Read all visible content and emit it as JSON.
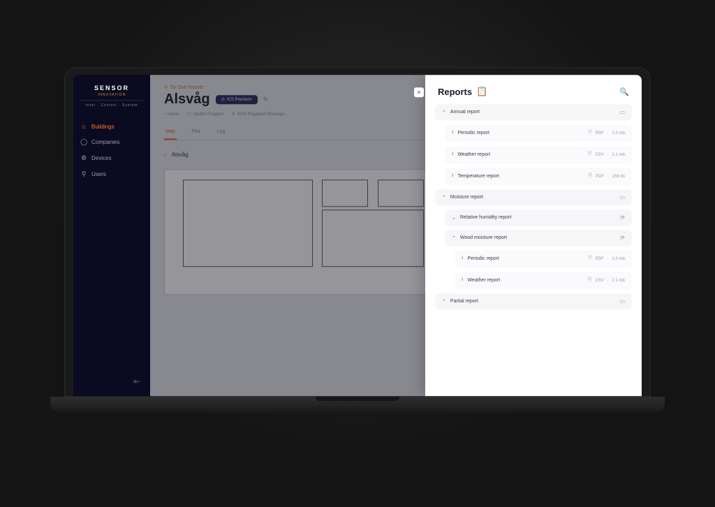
{
  "logo": {
    "name": "SENSOR",
    "sub": "INNOVATION",
    "tag": "Intel · Control · System"
  },
  "nav": {
    "items": [
      {
        "icon": "⌂",
        "label": "Buildings",
        "active": true
      },
      {
        "icon": "◯",
        "label": "Companies"
      },
      {
        "icon": "⚙",
        "label": "Devices"
      },
      {
        "icon": "⚲",
        "label": "Users"
      }
    ]
  },
  "page": {
    "owner_icon": "⚲",
    "owner": "Tor Ove Nesset",
    "title": "Alsvåg",
    "badge_icon": "◷",
    "badge": "ICS Premium",
    "edit_icon": "✎",
    "meta": [
      {
        "icon": "•",
        "text": "native"
      },
      {
        "icon": "▢",
        "text": "Vestbo Gruppen"
      },
      {
        "icon": "⚲",
        "text": "4015 Rogaland Stavange..."
      }
    ],
    "tabs": [
      {
        "label": "Map",
        "active": true
      },
      {
        "label": "Plot"
      },
      {
        "label": "Log"
      }
    ],
    "breadcrumb_icon": "‹",
    "breadcrumb": "Alsvåg"
  },
  "panel": {
    "close": "✕",
    "title": "Reports",
    "title_icon": "📋",
    "search_icon": "🔍",
    "rows": [
      {
        "type": "grp",
        "chev": "⌃",
        "label": "Annual report",
        "cls": ""
      },
      {
        "type": "file",
        "label": "Periodic report",
        "fmt": "PDF",
        "size": "1.0 mb",
        "cls": ""
      },
      {
        "type": "file",
        "label": "Weather report",
        "fmt": "CSV",
        "size": "2.1 mb",
        "cls": ""
      },
      {
        "type": "file",
        "label": "Temperature report",
        "fmt": "PDF",
        "size": "256 kb",
        "cls": ""
      },
      {
        "type": "grp",
        "chev": "⌃",
        "label": "Moisture report",
        "cls": ""
      },
      {
        "type": "grp",
        "chev": "⌄",
        "label": "Relative humidity report",
        "cls": "sub",
        "folder": "⟳"
      },
      {
        "type": "grp",
        "chev": "⌃",
        "label": "Wood moisture report",
        "cls": "sub",
        "folder": "⟳"
      },
      {
        "type": "file",
        "label": "Periodic report",
        "fmt": "PDF",
        "size": "1.0 mb",
        "cls": "sub2"
      },
      {
        "type": "file",
        "label": "Weather report",
        "fmt": "CSV",
        "size": "2.1 mb",
        "cls": "sub2"
      },
      {
        "type": "grp",
        "chev": "⌃",
        "label": "Partial report",
        "cls": ""
      }
    ]
  }
}
